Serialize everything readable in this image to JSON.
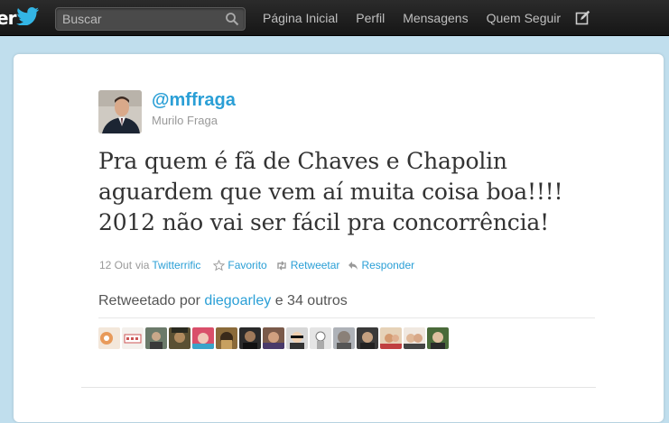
{
  "header": {
    "logo_text": "er",
    "search": {
      "placeholder": "Buscar"
    },
    "nav": [
      "Página Inicial",
      "Perfil",
      "Mensagens",
      "Quem Seguir"
    ],
    "icons": [
      "twitter-bird-icon",
      "search-icon",
      "compose-icon"
    ]
  },
  "tweet": {
    "screen_name": "@mffraga",
    "full_name": "Murilo Fraga",
    "text": "Pra quem é fã de Chaves e Chapolin aguardem que vem aí muita coisa boa!!!! 2012 não vai ser fácil pra concorrência!",
    "date": "12 Out",
    "via_label": "via",
    "client": "Twitterrific",
    "actions": {
      "favorite": "Favorito",
      "retweet": "Retweetar",
      "reply": "Responder"
    },
    "retweeted_by": {
      "prefix": "Retweetado por",
      "user": "diegoarley",
      "suffix": "e 34 outros"
    }
  },
  "colors": {
    "link": "#2a9fd6",
    "topbar": "#1f1f1f",
    "background": "#c0deed",
    "card": "#ffffff"
  }
}
